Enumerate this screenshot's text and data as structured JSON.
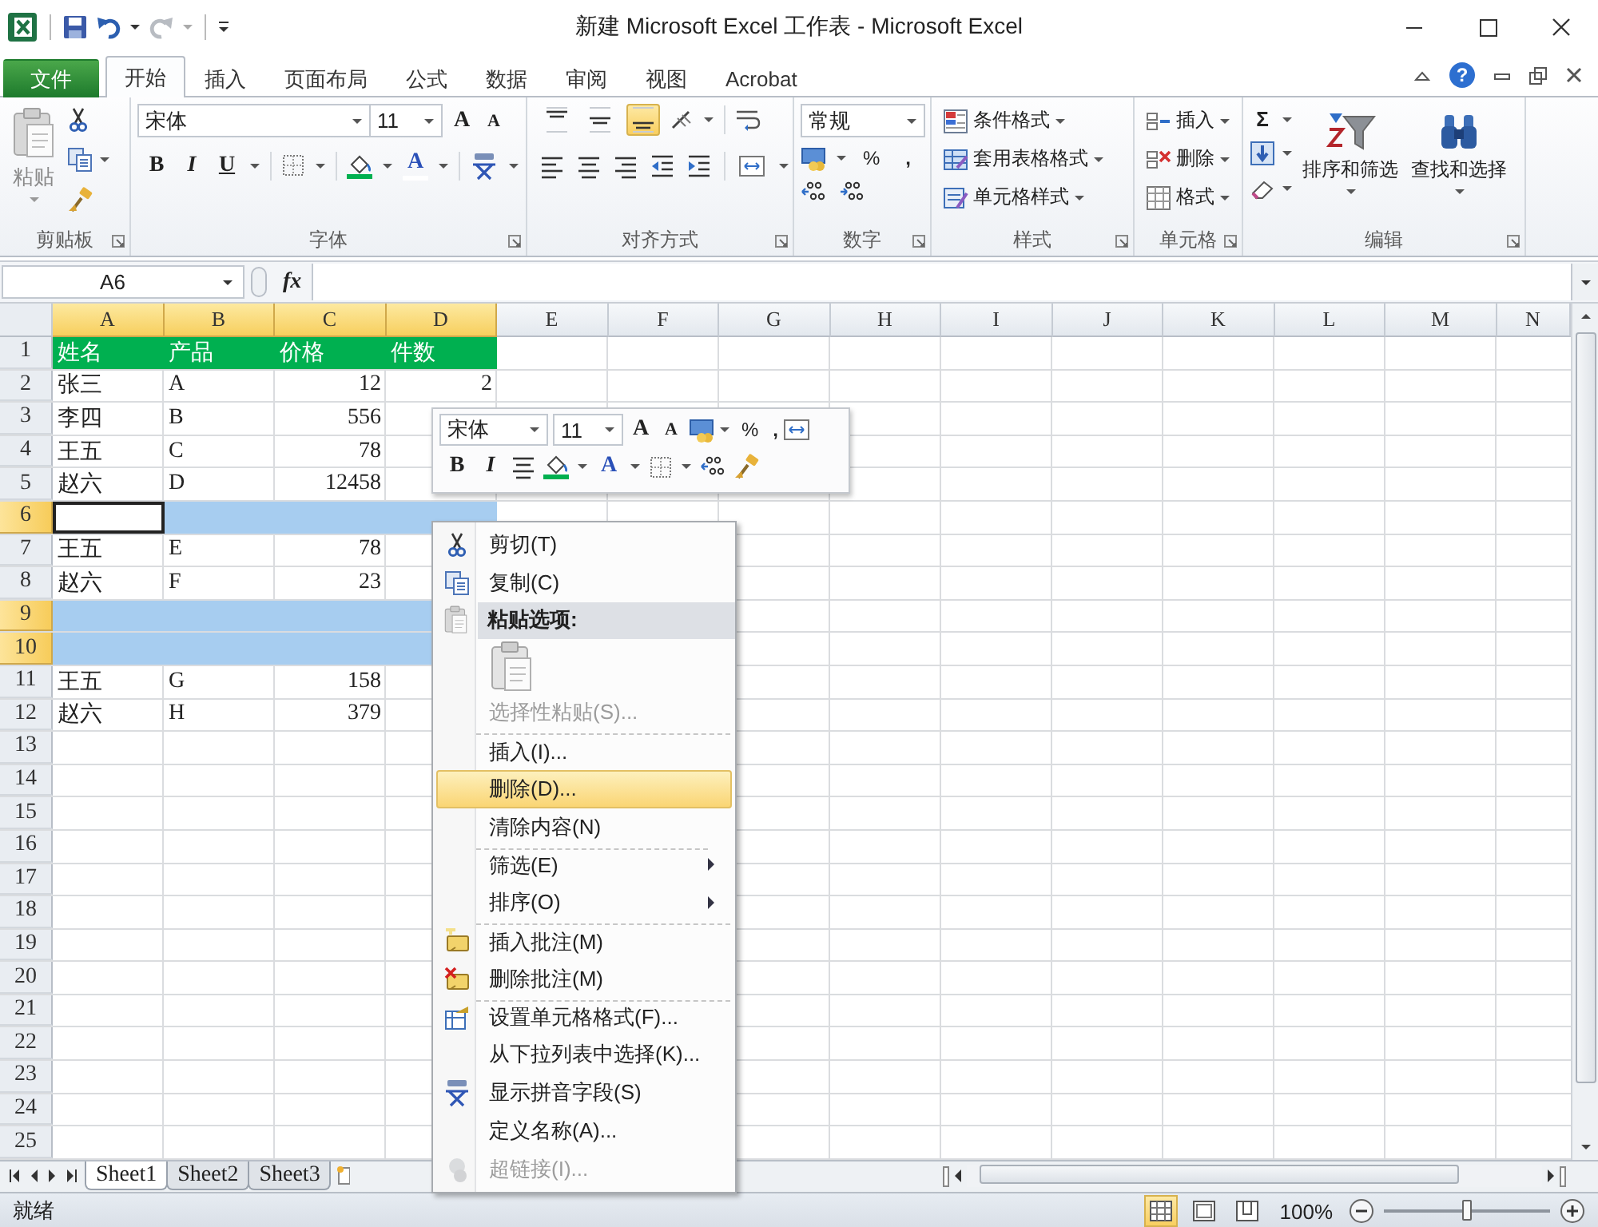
{
  "window": {
    "title": "新建 Microsoft Excel 工作表 - Microsoft Excel"
  },
  "ribbon_tabs": [
    {
      "label": "文件",
      "kind": "file",
      "selected": false
    },
    {
      "label": "开始",
      "kind": "tab",
      "selected": true
    },
    {
      "label": "插入",
      "kind": "tab",
      "selected": false
    },
    {
      "label": "页面布局",
      "kind": "tab",
      "selected": false
    },
    {
      "label": "公式",
      "kind": "tab",
      "selected": false
    },
    {
      "label": "数据",
      "kind": "tab",
      "selected": false
    },
    {
      "label": "审阅",
      "kind": "tab",
      "selected": false
    },
    {
      "label": "视图",
      "kind": "tab",
      "selected": false
    },
    {
      "label": "Acrobat",
      "kind": "tab",
      "selected": false
    }
  ],
  "help": "?",
  "ribbon": {
    "clipboard": {
      "paste": "粘贴",
      "label": "剪贴板"
    },
    "font": {
      "font_name": "宋体",
      "font_size": "11",
      "grow": "A",
      "shrink": "A",
      "bold": "B",
      "italic": "I",
      "underline": "U",
      "font_color": "A",
      "label": "字体"
    },
    "alignment": {
      "vertical_buttons": [
        {
          "selected": false
        },
        {
          "selected": false
        },
        {
          "selected": true
        }
      ],
      "label": "对齐方式"
    },
    "number": {
      "format": "常规",
      "percent": "%",
      "comma": ",",
      "label": "数字"
    },
    "styles": {
      "items": [
        "条件格式",
        "套用表格格式",
        "单元格样式"
      ],
      "label": "样式"
    },
    "cells": {
      "items": [
        "插入",
        "删除",
        "格式"
      ],
      "label": "单元格"
    },
    "editing": {
      "sum": "Σ",
      "items": [
        "排序和筛选",
        "查找和选择"
      ],
      "label": "编辑"
    }
  },
  "formula_bar": {
    "name_box": "A6",
    "fx": "fx"
  },
  "columns": [
    {
      "label": "A",
      "selected": true
    },
    {
      "label": "B",
      "selected": true
    },
    {
      "label": "C",
      "selected": true
    },
    {
      "label": "D",
      "selected": true
    },
    {
      "label": "E",
      "selected": false
    },
    {
      "label": "F",
      "selected": false
    },
    {
      "label": "G",
      "selected": false
    },
    {
      "label": "H",
      "selected": false
    },
    {
      "label": "I",
      "selected": false
    },
    {
      "label": "J",
      "selected": false
    },
    {
      "label": "K",
      "selected": false
    },
    {
      "label": "L",
      "selected": false
    },
    {
      "label": "M",
      "selected": false
    },
    {
      "label": "N",
      "selected": false
    }
  ],
  "rows": [
    {
      "number": "1",
      "kind": "header",
      "selected": false,
      "cells": [
        {
          "text": "姓名",
          "active": false
        },
        {
          "text": "产品",
          "active": false
        },
        {
          "text": "价格",
          "active": false
        },
        {
          "text": "件数",
          "active": false
        }
      ]
    },
    {
      "number": "2",
      "kind": "data",
      "selected": false,
      "cells": [
        {
          "text": "张三",
          "active": false
        },
        {
          "text": "A",
          "active": false
        },
        {
          "text": "12",
          "active": false
        },
        {
          "text": "2",
          "active": false
        }
      ]
    },
    {
      "number": "3",
      "kind": "data",
      "selected": false,
      "cells": [
        {
          "text": "李四",
          "active": false
        },
        {
          "text": "B",
          "active": false
        },
        {
          "text": "556",
          "active": false
        }
      ]
    },
    {
      "number": "4",
      "kind": "data",
      "selected": false,
      "cells": [
        {
          "text": "王五",
          "active": false
        },
        {
          "text": "C",
          "active": false
        },
        {
          "text": "78",
          "active": false
        }
      ]
    },
    {
      "number": "5",
      "kind": "data",
      "selected": false,
      "cells": [
        {
          "text": "赵六",
          "active": false
        },
        {
          "text": "D",
          "active": false
        },
        {
          "text": "12458",
          "active": false
        }
      ]
    },
    {
      "number": "6",
      "kind": "data",
      "selected": true,
      "cells": [
        {
          "active": true
        }
      ]
    },
    {
      "number": "7",
      "kind": "data",
      "selected": false,
      "cells": [
        {
          "text": "王五",
          "active": false
        },
        {
          "text": "E",
          "active": false
        },
        {
          "text": "78",
          "active": false
        }
      ]
    },
    {
      "number": "8",
      "kind": "data",
      "selected": false,
      "cells": [
        {
          "text": "赵六",
          "active": false
        },
        {
          "text": "F",
          "active": false
        },
        {
          "text": "23",
          "active": false
        }
      ]
    },
    {
      "number": "9",
      "kind": "data",
      "selected": true
    },
    {
      "number": "10",
      "kind": "data",
      "selected": true
    },
    {
      "number": "11",
      "kind": "data",
      "selected": false,
      "cells": [
        {
          "text": "王五",
          "active": false
        },
        {
          "text": "G",
          "active": false
        },
        {
          "text": "158",
          "active": false
        }
      ]
    },
    {
      "number": "12",
      "kind": "data",
      "selected": false,
      "cells": [
        {
          "text": "赵六",
          "active": false
        },
        {
          "text": "H",
          "active": false
        },
        {
          "text": "379",
          "active": false
        }
      ]
    },
    {
      "number": "13",
      "kind": "data",
      "selected": false
    },
    {
      "number": "14",
      "kind": "data",
      "selected": false
    },
    {
      "number": "15",
      "kind": "data",
      "selected": false
    },
    {
      "number": "16",
      "kind": "data",
      "selected": false
    },
    {
      "number": "17",
      "kind": "data",
      "selected": false
    },
    {
      "number": "18",
      "kind": "data",
      "selected": false
    },
    {
      "number": "19",
      "kind": "data",
      "selected": false
    },
    {
      "number": "20",
      "kind": "data",
      "selected": false
    },
    {
      "number": "21",
      "kind": "data",
      "selected": false
    },
    {
      "number": "22",
      "kind": "data",
      "selected": false
    },
    {
      "number": "23",
      "kind": "data",
      "selected": false
    },
    {
      "number": "24",
      "kind": "data",
      "selected": false
    },
    {
      "number": "25",
      "kind": "data",
      "selected": false
    }
  ],
  "sheet_tabs": [
    {
      "label": "Sheet1",
      "selected": true
    },
    {
      "label": "Sheet2",
      "selected": false
    },
    {
      "label": "Sheet3",
      "selected": false
    }
  ],
  "status_bar": {
    "status": "就绪",
    "views": [
      {
        "selected": true
      },
      {
        "selected": false
      },
      {
        "selected": false
      }
    ],
    "zoom": "100%",
    "zoom_slider": {
      "level": 0.5
    }
  },
  "mini_toolbar": {
    "font_name": "宋体",
    "font_size": "11",
    "grow": "A",
    "shrink": "A",
    "percent": "%",
    "comma": ",",
    "bold": "B",
    "italic": "I",
    "font_color": "A"
  },
  "context_menu": {
    "items": [
      {
        "kind": "item",
        "label": "剪切(T)",
        "selected": false,
        "disabled": false,
        "submenu": false,
        "separator_above": false
      },
      {
        "kind": "item",
        "label": "复制(C)",
        "selected": false,
        "disabled": false,
        "submenu": false,
        "separator_above": false
      },
      {
        "kind": "header",
        "label": "粘贴选项:",
        "selected": false,
        "disabled": false,
        "submenu": false,
        "separator_above": false
      },
      {
        "kind": "paste_options",
        "selected": false,
        "disabled": true,
        "submenu": false,
        "separator_above": false
      },
      {
        "kind": "item",
        "label": "选择性粘贴(S)...",
        "selected": false,
        "disabled": true,
        "submenu": false,
        "separator_above": false
      },
      {
        "kind": "item",
        "label": "插入(I)...",
        "selected": false,
        "disabled": false,
        "submenu": false,
        "separator_above": true
      },
      {
        "kind": "item",
        "label": "删除(D)...",
        "selected": true,
        "disabled": false,
        "submenu": false,
        "separator_above": false
      },
      {
        "kind": "item",
        "label": "清除内容(N)",
        "selected": false,
        "disabled": false,
        "submenu": false,
        "separator_above": false
      },
      {
        "kind": "item",
        "label": "筛选(E)",
        "selected": false,
        "disabled": false,
        "submenu": true,
        "separator_above": true
      },
      {
        "kind": "item",
        "label": "排序(O)",
        "selected": false,
        "disabled": false,
        "submenu": true,
        "separator_above": false
      },
      {
        "kind": "item",
        "label": "插入批注(M)",
        "selected": false,
        "disabled": false,
        "submenu": false,
        "separator_above": true
      },
      {
        "kind": "item",
        "label": "删除批注(M)",
        "selected": false,
        "disabled": false,
        "submenu": false,
        "separator_above": false
      },
      {
        "kind": "item",
        "label": "设置单元格格式(F)...",
        "selected": false,
        "disabled": false,
        "submenu": false,
        "separator_above": true
      },
      {
        "kind": "item",
        "label": "从下拉列表中选择(K)...",
        "selected": false,
        "disabled": false,
        "submenu": false,
        "separator_above": false
      },
      {
        "kind": "item",
        "label": "显示拼音字段(S)",
        "selected": false,
        "disabled": false,
        "submenu": false,
        "separator_above": false
      },
      {
        "kind": "item",
        "label": "定义名称(A)...",
        "selected": false,
        "disabled": false,
        "submenu": false,
        "separator_above": false
      },
      {
        "kind": "item",
        "label": "超链接(I)...",
        "selected": false,
        "disabled": true,
        "submenu": false,
        "separator_above": false
      }
    ]
  }
}
